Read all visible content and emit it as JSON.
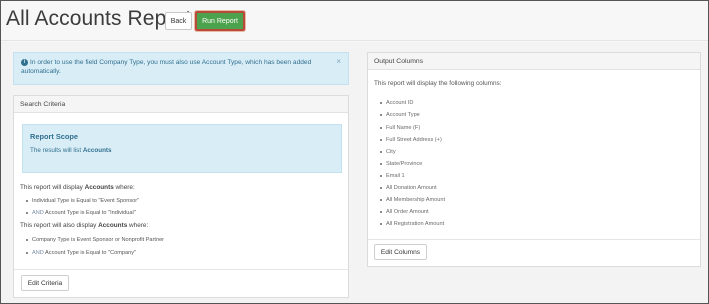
{
  "header": {
    "title": "All Accounts Report",
    "back_label": "Back",
    "run_label": "Run Report"
  },
  "alert": {
    "info_icon": "info-circle-icon",
    "text": "In order to use the field Company Type, you must also use Account Type, which has been added automatically.",
    "close": "×"
  },
  "search_criteria": {
    "heading": "Search Criteria",
    "scope_title": "Report Scope",
    "scope_prefix": "The results will list ",
    "scope_entity": "Accounts",
    "display_prefix": "This report will display ",
    "display_entity": "Accounts",
    "display_suffix": " where:",
    "group1": [
      {
        "op": "",
        "text": "Individual Type is Equal to \"Event Sponsor\""
      },
      {
        "op": "AND",
        "text": " Account Type is Equal to \"Individual\""
      }
    ],
    "also_prefix": "This report will also display ",
    "also_entity": "Accounts",
    "also_suffix": " where:",
    "group2": [
      {
        "op": "",
        "text": "Company Type is  Event Sponsor or Nonprofit Partner"
      },
      {
        "op": "AND",
        "text": " Account Type is Equal to \"Company\""
      }
    ],
    "edit_label": "Edit Criteria"
  },
  "output_columns": {
    "heading": "Output Columns",
    "intro": "This report will display the following columns:",
    "columns": [
      "Account ID",
      "Account Type",
      "Full Name (F)",
      "Full Street Address (+)",
      "City",
      "State/Province",
      "Email 1",
      "All Donation Amount",
      "All Membership Amount",
      "All Order Amount",
      "All Registration Amount"
    ],
    "edit_label": "Edit Columns"
  }
}
